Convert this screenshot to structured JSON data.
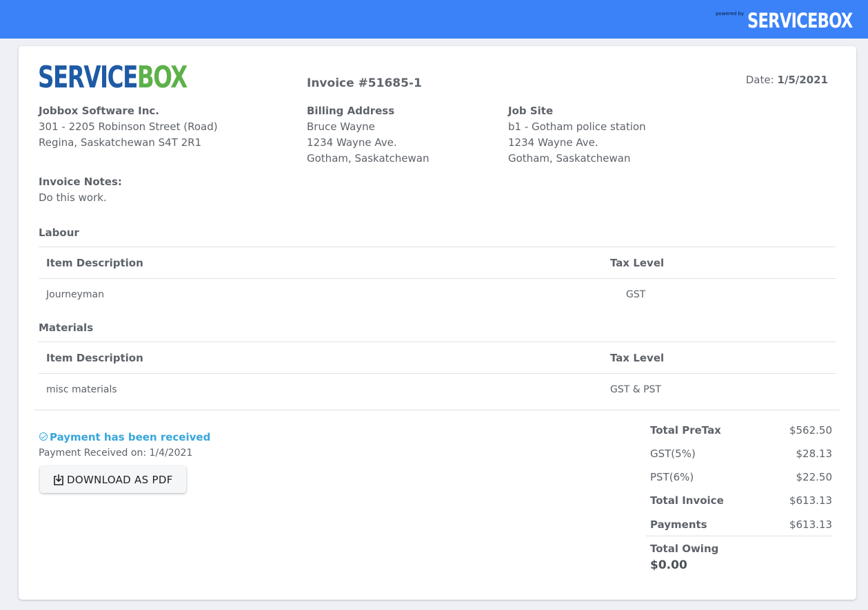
{
  "topbar": {
    "powered_by": "powered by",
    "brand": "SERVICEBOX",
    "color": "#3b82f8"
  },
  "logo": {
    "part1": "SERVICE",
    "part2": "BOX",
    "color1": "#1f5aa6",
    "color2": "#5db14a"
  },
  "invoice": {
    "number": "Invoice #51685-1",
    "date_label": "Date:",
    "date": "1/5/2021"
  },
  "company": {
    "name": "Jobbox Software Inc.",
    "line1": "301 - 2205 Robinson Street (Road)",
    "line2": "Regina, Saskatchewan S4T 2R1"
  },
  "billing": {
    "heading": "Billing Address",
    "name": "Bruce Wayne",
    "line1": "1234 Wayne Ave.",
    "line2": "Gotham, Saskatchewan"
  },
  "jobsite": {
    "heading": "Job Site",
    "name": "b1 - Gotham police station",
    "line1": "1234 Wayne Ave.",
    "line2": "Gotham, Saskatchewan"
  },
  "notes": {
    "heading": "Invoice Notes:",
    "text": "Do this work."
  },
  "labour": {
    "heading": "Labour",
    "columns": [
      "Item Description",
      "Tax Level"
    ],
    "rows": [
      [
        "Journeyman",
        "GST"
      ]
    ]
  },
  "materials": {
    "heading": "Materials",
    "columns": [
      "Item Description",
      "Tax Level"
    ],
    "rows": [
      [
        "misc materials",
        "GST & PST"
      ]
    ]
  },
  "payment": {
    "status": "Payment has been received",
    "received": "Payment Received on: 1/4/2021",
    "status_color": "#37a6dc"
  },
  "download": {
    "label": "DOWNLOAD AS PDF",
    "icon": "download-icon"
  },
  "totals": {
    "pretax_label": "Total PreTax",
    "pretax": "$562.50",
    "gst_label": "GST(5%)",
    "gst": "$28.13",
    "pst_label": "PST(6%)",
    "pst": "$22.50",
    "invoice_label": "Total Invoice",
    "invoice": "$613.13",
    "payments_label": "Payments",
    "payments": "$613.13",
    "owing_label": "Total Owing",
    "owing": "$0.00"
  }
}
